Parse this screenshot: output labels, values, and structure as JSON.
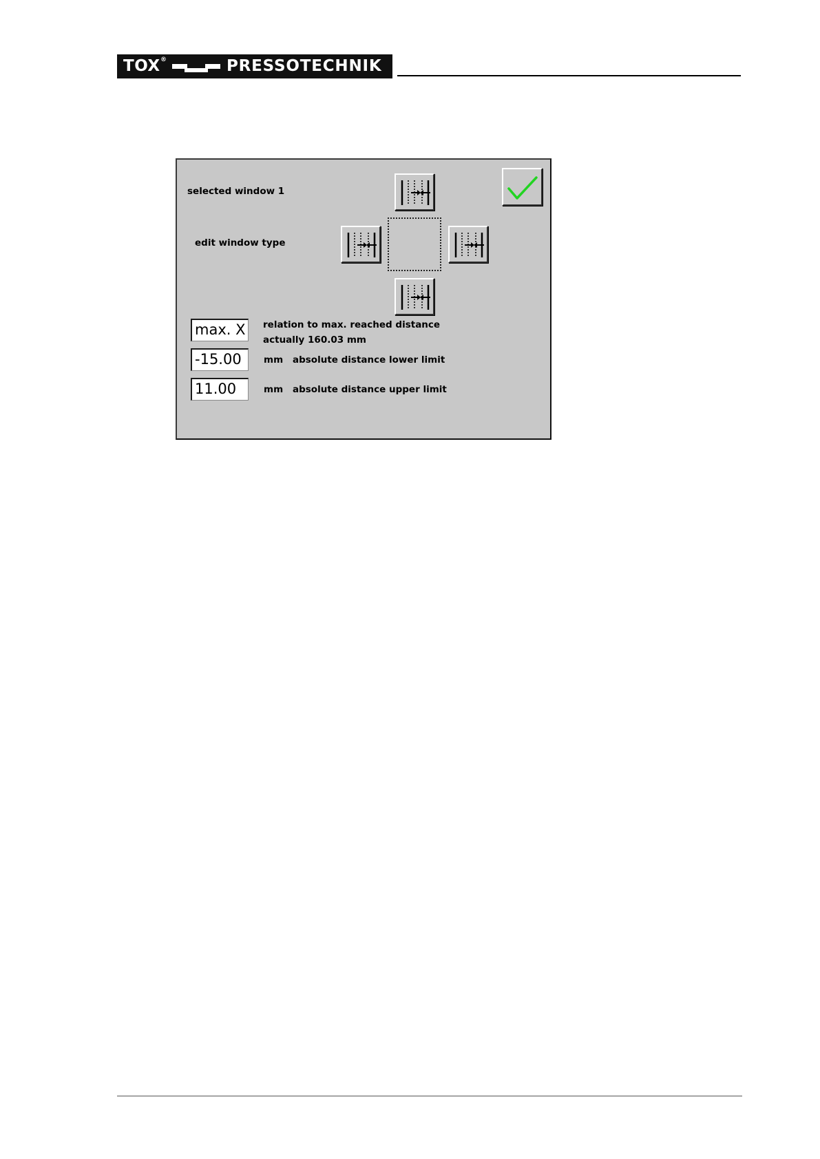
{
  "header": {
    "brand_left": "TOX",
    "brand_reg": "®",
    "brand_right": "PRESSOTECHNIK"
  },
  "dialog": {
    "selected_window_label": "selected window 1",
    "edit_window_type_label": "edit window type",
    "confirm_icon": "green-checkmark-icon",
    "window_type_icon": "limit-lines-arrows-icon",
    "accent_color": "#22d422",
    "reference": {
      "value": "max. X",
      "text_line1": "relation to max. reached distance",
      "text_line2": "actually 160.03 mm"
    },
    "lower_limit": {
      "value": "-15.00",
      "unit": "mm",
      "label": "absolute distance lower limit"
    },
    "upper_limit": {
      "value": "11.00",
      "unit": "mm",
      "label": "absolute distance upper limit"
    }
  }
}
